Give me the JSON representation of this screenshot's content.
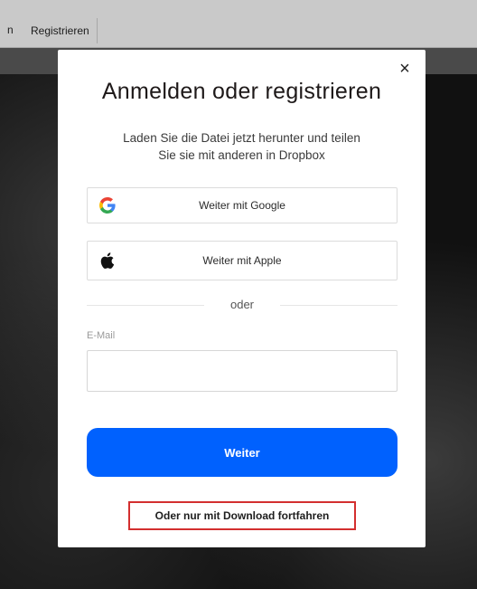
{
  "header": {
    "prev_nav_fragment": "n",
    "register_link": "Registrieren"
  },
  "modal": {
    "close_glyph": "×",
    "title": "Anmelden oder registrieren",
    "subtitle_line1": "Laden Sie die Datei jetzt herunter und teilen",
    "subtitle_line2": "Sie sie mit anderen in Dropbox",
    "google_button": "Weiter mit Google",
    "apple_button": "Weiter mit Apple",
    "divider_text": "oder",
    "email_label": "E-Mail",
    "email_value": "",
    "continue_button": "Weiter",
    "download_only_link": "Oder nur mit Download fortfahren"
  },
  "colors": {
    "primary": "#0061fe",
    "highlight_border": "#d32f2f"
  }
}
